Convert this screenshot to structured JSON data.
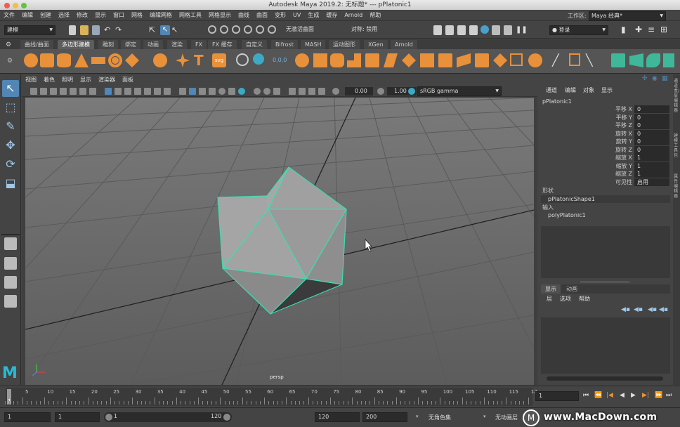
{
  "window": {
    "title": "Autodesk Maya 2019.2: 无标题*   ---   pPlatonic1"
  },
  "menu": [
    "文件",
    "编辑",
    "创建",
    "选择",
    "修改",
    "显示",
    "窗口",
    "网格",
    "编辑网格",
    "网格工具",
    "网格显示",
    "曲线",
    "曲面",
    "变形",
    "UV",
    "生成",
    "缓存",
    "Arnold",
    "帮助"
  ],
  "statusline": {
    "mode": "建模",
    "live_surface": "无激活曲面",
    "symmetry": "对称: 禁用",
    "login": "登录",
    "workspace_label": "工作区:",
    "workspace": "Maya 经典*"
  },
  "shelf_tabs": [
    "曲线/曲面",
    "多边形建模",
    "雕刻",
    "绑定",
    "动画",
    "渲染",
    "FX",
    "FX 缓存",
    "自定义",
    "Bifrost",
    "MASH",
    "运动图形",
    "XGen",
    "Arnold"
  ],
  "active_shelf_tab": "多边形建模",
  "viewport": {
    "menu": [
      "视图",
      "着色",
      "照明",
      "显示",
      "渲染器",
      "面板"
    ],
    "exposure": "0.00",
    "gamma": "1.00",
    "color_space": "sRGB gamma",
    "camera_label": "persp"
  },
  "channel_box": {
    "tabs": [
      "通道",
      "编辑",
      "对象",
      "显示"
    ],
    "object_name": "pPlatonic1",
    "attributes": [
      {
        "name": "平移 X",
        "value": "0"
      },
      {
        "name": "平移 Y",
        "value": "0"
      },
      {
        "name": "平移 Z",
        "value": "0"
      },
      {
        "name": "旋转 X",
        "value": "0"
      },
      {
        "name": "旋转 Y",
        "value": "0"
      },
      {
        "name": "旋转 Z",
        "value": "0"
      },
      {
        "name": "缩放 X",
        "value": "1"
      },
      {
        "name": "缩放 Y",
        "value": "1"
      },
      {
        "name": "缩放 Z",
        "value": "1"
      },
      {
        "name": "可见性",
        "value": "启用"
      }
    ],
    "shapes_label": "形状",
    "shape_name": "pPlatonicShape1",
    "inputs_label": "输入",
    "input_name": "polyPlatonic1"
  },
  "layer_editor": {
    "tabs": [
      "显示",
      "动画"
    ],
    "menu": [
      "层",
      "选项",
      "帮助"
    ]
  },
  "right_strip": [
    "通道盒/层编辑器",
    "建模工具包",
    "属性编辑器"
  ],
  "timeline": {
    "ticks": [
      "5",
      "10",
      "15",
      "20",
      "25",
      "30",
      "35",
      "40",
      "45",
      "50",
      "55",
      "60",
      "65",
      "70",
      "75",
      "80",
      "85",
      "90",
      "95",
      "100",
      "105",
      "110",
      "115",
      "12"
    ],
    "current_frame_marker": "1",
    "current_frame": "1"
  },
  "range": {
    "start": "1",
    "anim_start": "1",
    "slider_start": "1",
    "slider_end": "120",
    "end": "120",
    "anim_end": "200",
    "char_set": "无角色集",
    "anim_layer": "无动画层"
  },
  "watermark": "www.MacDown.com",
  "colors": {
    "selection": "#3fdcb0",
    "accent": "#e8903a",
    "selected_tool": "#5286b5"
  }
}
